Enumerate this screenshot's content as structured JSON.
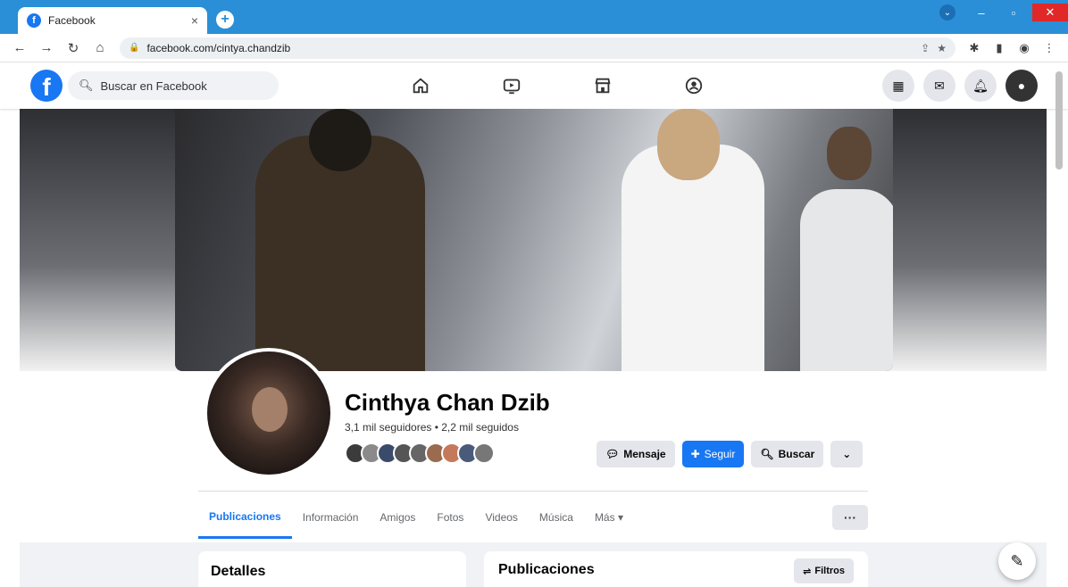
{
  "browser": {
    "tab_title": "Facebook",
    "tab_close": "×",
    "new_tab": "+",
    "url": "facebook.com/cintya.chandzib",
    "win": {
      "minimize": "–",
      "maximize": "▫",
      "close": "✕",
      "profile": "⌄"
    }
  },
  "fb": {
    "logo": "f",
    "search_placeholder": "Buscar en Facebook"
  },
  "profile": {
    "name": "Cinthya Chan Dzib",
    "followers": "3,1 mil seguidores • 2,2 mil seguidos",
    "friend_colors": [
      "#3b3b3b",
      "#8a8a8a",
      "#3a4a6a",
      "#555",
      "#666",
      "#9a6b4f",
      "#c47a5a",
      "#4a5a7a",
      "#777"
    ],
    "actions": {
      "message": "Mensaje",
      "follow": "Seguir",
      "search": "Buscar",
      "dropdown": "⌄"
    }
  },
  "tabs": [
    "Publicaciones",
    "Información",
    "Amigos",
    "Fotos",
    "Videos",
    "Música",
    "Más ▾"
  ],
  "more_button": "···",
  "cards": {
    "details_title": "Detalles",
    "posts_title": "Publicaciones",
    "filters": "Filtros"
  },
  "colors": {
    "brand": "#1877f2",
    "chrome_blue": "#2a8fd6"
  }
}
